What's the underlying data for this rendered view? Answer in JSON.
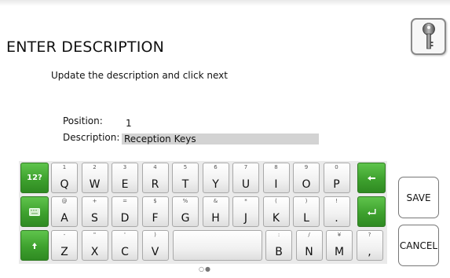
{
  "screen": {
    "title": "ENTER DESCRIPTION",
    "subtitle": "Update the description and click next"
  },
  "form": {
    "position_label": "Position:",
    "position_value": "1",
    "description_label": "Description:",
    "description_value": "Reception Keys"
  },
  "keyboard": {
    "row1": [
      {
        "main": "Q",
        "alt": "1"
      },
      {
        "main": "W",
        "alt": "2"
      },
      {
        "main": "E",
        "alt": "3"
      },
      {
        "main": "R",
        "alt": "4"
      },
      {
        "main": "T",
        "alt": "5"
      },
      {
        "main": "Y",
        "alt": "6"
      },
      {
        "main": "U",
        "alt": "7"
      },
      {
        "main": "I",
        "alt": "8"
      },
      {
        "main": "O",
        "alt": "9"
      },
      {
        "main": "P",
        "alt": "0"
      }
    ],
    "row2": [
      {
        "main": "A",
        "alt": "@"
      },
      {
        "main": "S",
        "alt": "+"
      },
      {
        "main": "D",
        "alt": "="
      },
      {
        "main": "F",
        "alt": "$"
      },
      {
        "main": "G",
        "alt": "%"
      },
      {
        "main": "H",
        "alt": "&"
      },
      {
        "main": "J",
        "alt": "*"
      },
      {
        "main": "K",
        "alt": "("
      },
      {
        "main": "L",
        "alt": ")"
      },
      {
        "main": ".",
        "alt": "!"
      }
    ],
    "row3_left": [
      {
        "main": "Z",
        "alt": "-"
      },
      {
        "main": "X",
        "alt": "\""
      },
      {
        "main": "C",
        "alt": "'"
      },
      {
        "main": "V",
        "alt": ")"
      }
    ],
    "row3_right": [
      {
        "main": "B",
        "alt": ":"
      },
      {
        "main": "N",
        "alt": "/"
      },
      {
        "main": "M",
        "alt": "¥"
      },
      {
        "main": ",",
        "alt": "?"
      }
    ],
    "numbers_toggle_label": "12?",
    "icons": {
      "toggle_layout": "keyboard-icon",
      "shift": "shift-up-arrow-icon",
      "backspace": "backspace-arrow-icon",
      "enter": "enter-return-icon"
    },
    "page_indicator": "○●"
  },
  "buttons": {
    "save": "SAVE",
    "cancel": "CANCEL",
    "key_icon": "key-icon"
  },
  "colors": {
    "accent_green": "#3ea12e",
    "field_gray": "#d3d3d3"
  }
}
